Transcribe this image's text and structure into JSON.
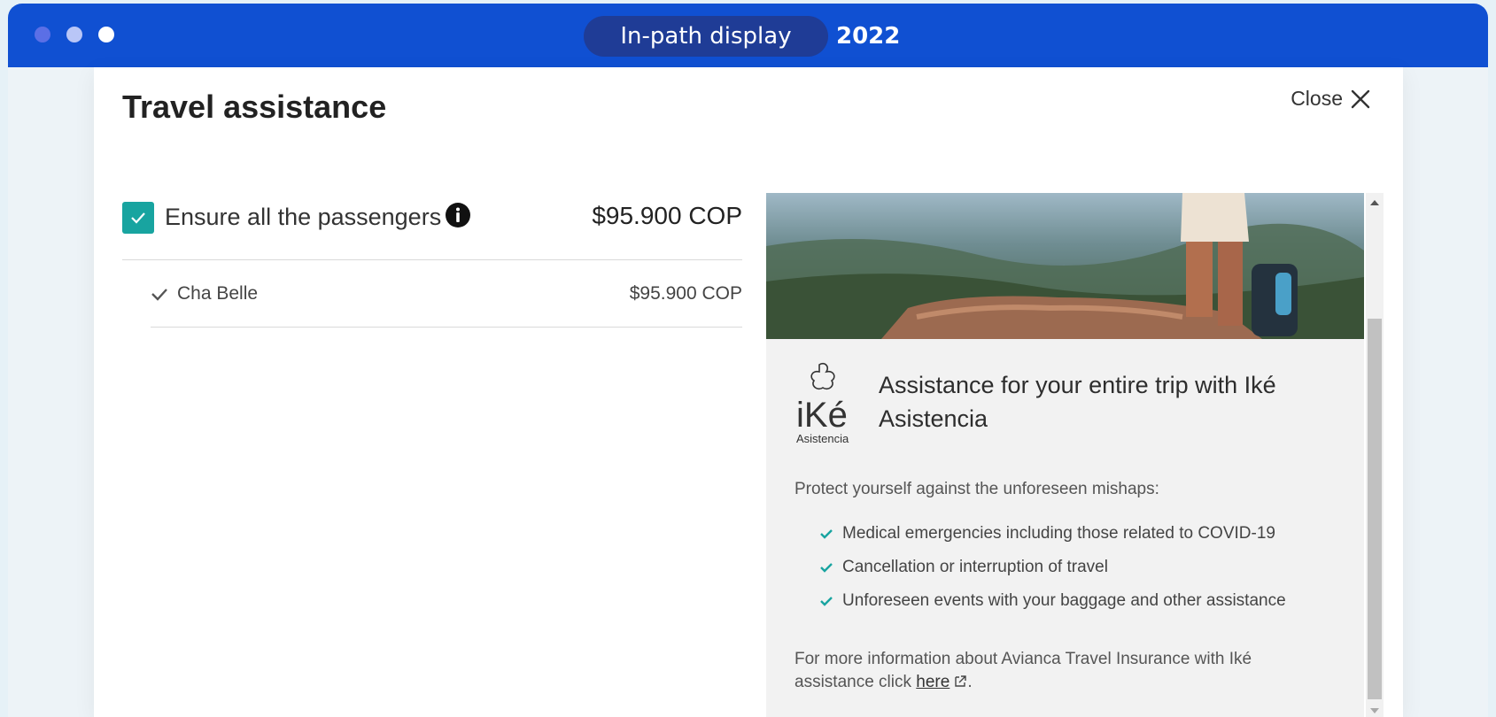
{
  "window": {
    "badge_label": "In-path display",
    "year": "2022"
  },
  "modal": {
    "title": "Travel assistance",
    "close_label": "Close",
    "ensure": {
      "label": "Ensure all the passengers",
      "checked": true,
      "price": "$95.900 COP"
    },
    "passengers": [
      {
        "name": "Cha Belle",
        "price": "$95.900 COP"
      }
    ],
    "card": {
      "logo_text": "iKé",
      "logo_subtext": "Asistencia",
      "title": "Assistance for your entire trip with Iké Asistencia",
      "intro": "Protect yourself against the unforeseen mishaps:",
      "benefits": [
        "Medical emergencies including those related to COVID-19",
        "Cancellation or interruption of travel",
        "Unforeseen events with your baggage and other assistance"
      ],
      "more_info_prefix": "For more information about Avianca Travel Insurance with Iké assistance click ",
      "link_label": "here",
      "more_info_suffix": "."
    }
  },
  "colors": {
    "titlebar": "#1050d2",
    "badge": "#1f3c96",
    "accent": "#18a4a0"
  }
}
